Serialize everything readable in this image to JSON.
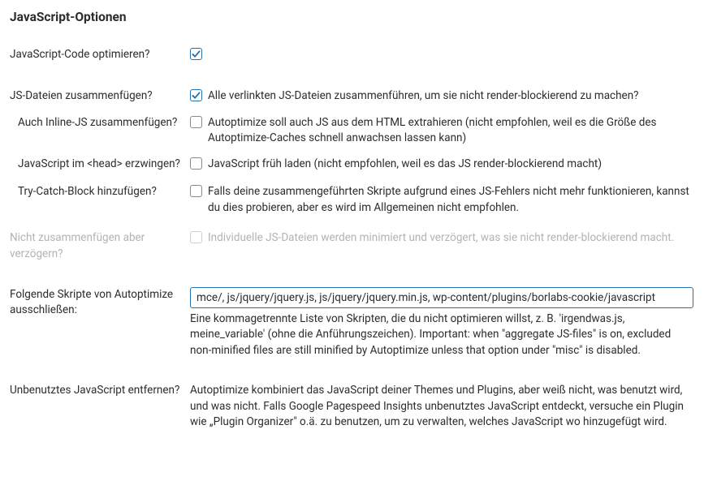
{
  "title": "JavaScript-Optionen",
  "rows": {
    "optimize": {
      "label": "JavaScript-Code optimieren?",
      "desc": ""
    },
    "aggregate": {
      "label": "JS-Dateien zusammenfügen?",
      "desc": "Alle verlinkten JS-Dateien zusammenführen, um sie nicht render-blockierend zu machen?"
    },
    "inline": {
      "label": "Auch Inline-JS zusammenfügen?",
      "desc": "Autoptimize soll auch JS aus dem HTML extrahieren (nicht empfohlen, weil es die Größe des Autoptimize-Caches schnell anwachsen lassen kann)"
    },
    "forcehead": {
      "label": "JavaScript im <head> erzwingen?",
      "desc": "JavaScript früh laden (nicht empfohlen, weil es das JS render-blockierend macht)"
    },
    "trycatch": {
      "label": "Try-Catch-Block hinzufügen?",
      "desc": "Falls deine zusammengeführten Skripte aufgrund eines JS-Fehlers nicht mehr funktionieren, kannst du dies probieren, aber es wird im Allgemeinen nicht empfohlen."
    },
    "defer": {
      "label": "Nicht zusammenfügen aber verzögern?",
      "desc": "Individuelle JS-Dateien werden minimiert und verzögert, was sie nicht render-blockierend macht."
    },
    "exclude": {
      "label": "Folgende Skripte von Autoptimize ausschließen:",
      "value": "mce/, js/jquery/jquery.js, js/jquery/jquery.min.js, wp-content/plugins/borlabs-cookie/javascript",
      "help": "Eine kommagetrennte Liste von Skripten, die du nicht optimieren willst, z. B. 'irgendwas.js, meine_variable' (ohne die Anführungszeichen). Important: when \"aggregate JS-files\" is on, excluded non-minified files are still minified by Autoptimize unless that option under \"misc\" is disabled."
    },
    "unused": {
      "label": "Unbenutztes JavaScript entfernen?",
      "desc": "Autoptimize kombiniert das JavaScript deiner Themes und Plugins, aber weiß nicht, was benutzt wird, und was nicht. Falls Google Pagespeed Insights unbenutztes JavaScript entdeckt, versuche ein Plugin wie „Plugin Organizer\" o.ä. zu benutzen, um zu verwalten, welches JavaScript wo hinzugefügt wird."
    }
  }
}
